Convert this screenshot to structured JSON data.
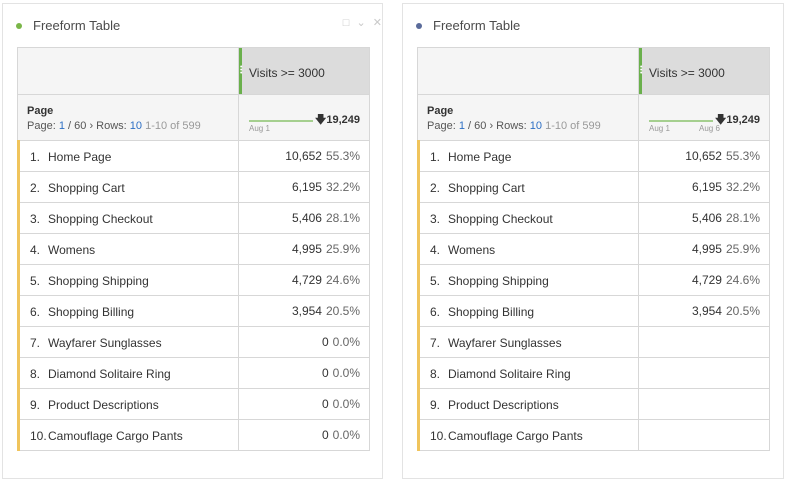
{
  "colors": {
    "left_dot": "#7ab648",
    "right_dot": "#5a6b9a",
    "segment_strip": "#6ab04c",
    "row_accent": "#f0c45c"
  },
  "panels": [
    {
      "title": "Freeform Table",
      "segment": "Visits >= 3000",
      "dimension": "Page",
      "paging": {
        "page_label": "Page:",
        "page": "1",
        "sep": "/",
        "pages": "60",
        "rows_label": "Rows:",
        "rows": "10",
        "range": "1-10 of 599"
      },
      "sparkline": {
        "start": "Aug 1",
        "end": ""
      },
      "total": "19,249",
      "rows": [
        {
          "idx": "1.",
          "label": "Home Page",
          "value": "10,652",
          "pct": "55.3%"
        },
        {
          "idx": "2.",
          "label": "Shopping Cart",
          "value": "6,195",
          "pct": "32.2%"
        },
        {
          "idx": "3.",
          "label": "Shopping Checkout",
          "value": "5,406",
          "pct": "28.1%"
        },
        {
          "idx": "4.",
          "label": "Womens",
          "value": "4,995",
          "pct": "25.9%"
        },
        {
          "idx": "5.",
          "label": "Shopping Shipping",
          "value": "4,729",
          "pct": "24.6%"
        },
        {
          "idx": "6.",
          "label": "Shopping Billing",
          "value": "3,954",
          "pct": "20.5%"
        },
        {
          "idx": "7.",
          "label": "Wayfarer Sunglasses",
          "value": "0",
          "pct": "0.0%"
        },
        {
          "idx": "8.",
          "label": "Diamond Solitaire Ring",
          "value": "0",
          "pct": "0.0%"
        },
        {
          "idx": "9.",
          "label": "Product Descriptions",
          "value": "0",
          "pct": "0.0%"
        },
        {
          "idx": "10.",
          "label": "Camouflage Cargo Pants",
          "value": "0",
          "pct": "0.0%"
        }
      ]
    },
    {
      "title": "Freeform Table",
      "segment": "Visits >= 3000",
      "dimension": "Page",
      "paging": {
        "page_label": "Page:",
        "page": "1",
        "sep": "/",
        "pages": "60",
        "rows_label": "Rows:",
        "rows": "10",
        "range": "1-10 of 599"
      },
      "sparkline": {
        "start": "Aug 1",
        "end": "Aug 6"
      },
      "total": "19,249",
      "rows": [
        {
          "idx": "1.",
          "label": "Home Page",
          "value": "10,652",
          "pct": "55.3%"
        },
        {
          "idx": "2.",
          "label": "Shopping Cart",
          "value": "6,195",
          "pct": "32.2%"
        },
        {
          "idx": "3.",
          "label": "Shopping Checkout",
          "value": "5,406",
          "pct": "28.1%"
        },
        {
          "idx": "4.",
          "label": "Womens",
          "value": "4,995",
          "pct": "25.9%"
        },
        {
          "idx": "5.",
          "label": "Shopping Shipping",
          "value": "4,729",
          "pct": "24.6%"
        },
        {
          "idx": "6.",
          "label": "Shopping Billing",
          "value": "3,954",
          "pct": "20.5%"
        },
        {
          "idx": "7.",
          "label": "Wayfarer Sunglasses",
          "value": "",
          "pct": ""
        },
        {
          "idx": "8.",
          "label": "Diamond Solitaire Ring",
          "value": "",
          "pct": ""
        },
        {
          "idx": "9.",
          "label": "Product Descriptions",
          "value": "",
          "pct": ""
        },
        {
          "idx": "10.",
          "label": "Camouflage Cargo Pants",
          "value": "",
          "pct": ""
        }
      ]
    }
  ],
  "icons": [
    "status-dot-icon",
    "copy-icon",
    "chevron-down-icon",
    "close-icon",
    "drag-handle-icon",
    "sort-down-arrow-icon",
    "chevron-right-icon"
  ]
}
